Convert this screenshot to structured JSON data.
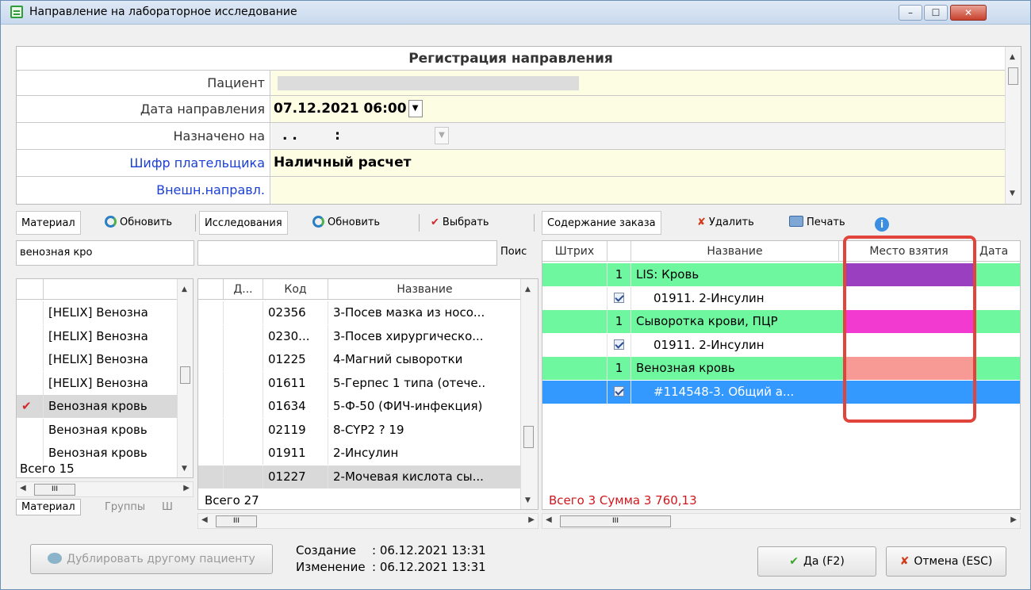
{
  "window": {
    "title": "Направление на лабораторное исследование",
    "min": "–",
    "max": "☐",
    "close": "✕"
  },
  "form": {
    "header": "Регистрация направления",
    "patient_label": "Пациент",
    "date_label": "Дата направления",
    "date_value": "07.12.2021 06:00",
    "assigned_label": "Назначено на",
    "assigned_value": ". .        :",
    "payer_label": "Шифр плательщика",
    "payer_value": "Наличный расчет",
    "external_label": "Внешн.направл."
  },
  "material_panel": {
    "tab": "Материал",
    "refresh": "Обновить",
    "search_value": "венозная кро",
    "rows": [
      "[HELIX] Венозна",
      "[HELIX] Венозна",
      "[HELIX] Венозна",
      "[HELIX] Венозна",
      "Венозная кровь",
      "Венозная кровь",
      "Венозная кровь"
    ],
    "total": "Всего 15",
    "bottom_tabs": [
      "Материал",
      "Группы",
      "Ш"
    ]
  },
  "research_panel": {
    "tab": "Исследования",
    "refresh": "Обновить",
    "select": "Выбрать",
    "search_button": "Поис",
    "columns": [
      "Д...",
      "Код",
      "Название"
    ],
    "rows": [
      {
        "code": "02356",
        "name": "3-Посев мазка из носо..."
      },
      {
        "code": "0230...",
        "name": "3-Посев хирургическо..."
      },
      {
        "code": "01225",
        "name": "4-Магний сыворотки"
      },
      {
        "code": "01611",
        "name": "5-Герпес 1 типа (отече.."
      },
      {
        "code": "01634",
        "name": "5-Ф-50 (ФИЧ-инфекция)"
      },
      {
        "code": "02119",
        "name": "8-CYP2 ? 19"
      },
      {
        "code": "01911",
        "name": "2-Инсулин"
      },
      {
        "code": "01227",
        "name": "2-Мочевая кислота сы..."
      }
    ],
    "total": "Всего 27"
  },
  "order_panel": {
    "tab": "Содержание заказа",
    "delete": "Удалить",
    "print": "Печать",
    "columns": [
      "Штрих",
      "Название",
      "Место взятия",
      "Дата"
    ],
    "rows": [
      {
        "count": "1",
        "name": "LIS: Кровь",
        "place_color": "#9a3fc0"
      },
      {
        "name": "01911. 2-Инсулин"
      },
      {
        "count": "1",
        "name": "Сыворотка крови, ПЦР",
        "place_color": "#f23ad0"
      },
      {
        "name": "01911. 2-Инсулин"
      },
      {
        "count": "1",
        "name": "Венозная кровь",
        "place_color": "#f79a96"
      },
      {
        "name": "#114548-3. Общий а..."
      }
    ],
    "total": "Всего 3 Сумма 3 760,13"
  },
  "footer": {
    "duplicate": "Дублировать другому пациенту",
    "created_label": "Создание",
    "created_value": ": 06.12.2021 13:31",
    "modified_label": "Изменение",
    "modified_value": ": 06.12.2021 13:31",
    "ok": "Да (F2)",
    "cancel": "Отмена (ESC)"
  },
  "colors": {
    "green_row": "#6ff7a0",
    "selected_row": "#3399ff",
    "highlight": "#e0443a"
  }
}
